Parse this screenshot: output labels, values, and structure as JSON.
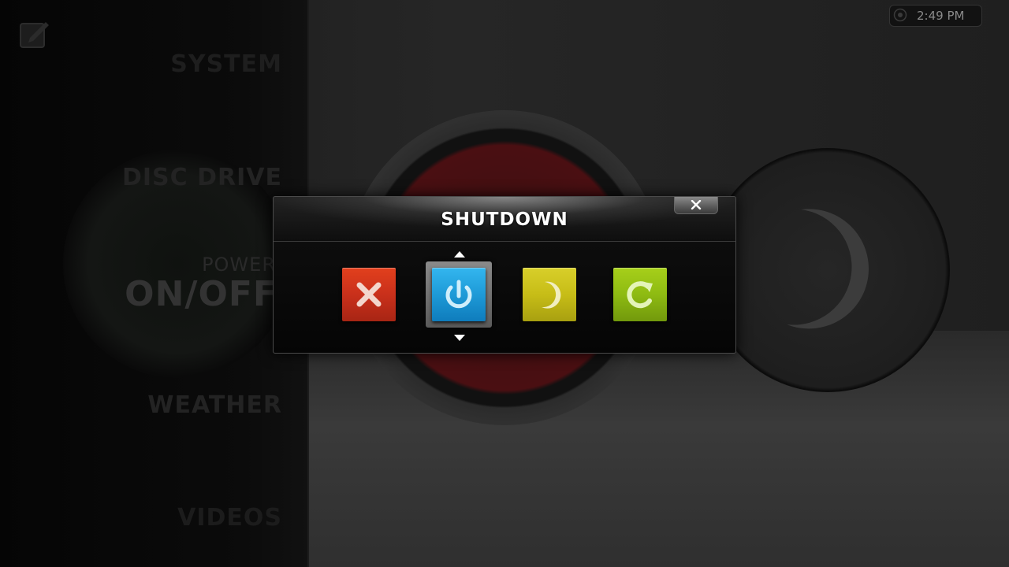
{
  "sidebar": {
    "items": [
      {
        "label": "SYSTEM"
      },
      {
        "label": "DISC DRIVE"
      },
      {
        "sublabel": "POWER",
        "label": "ON/OFF"
      },
      {
        "label": "WEATHER"
      },
      {
        "label": "VIDEOS"
      }
    ]
  },
  "clock": {
    "time": "2:49 PM"
  },
  "dialog": {
    "title": "SHUTDOWN",
    "options": [
      {
        "icon": "close-x-icon",
        "color": "#d43a1c"
      },
      {
        "icon": "power-icon",
        "color": "#1e9ad7",
        "selected": true
      },
      {
        "icon": "moon-icon",
        "color": "#c7bd17"
      },
      {
        "icon": "refresh-icon",
        "color": "#8ebb12"
      }
    ]
  }
}
